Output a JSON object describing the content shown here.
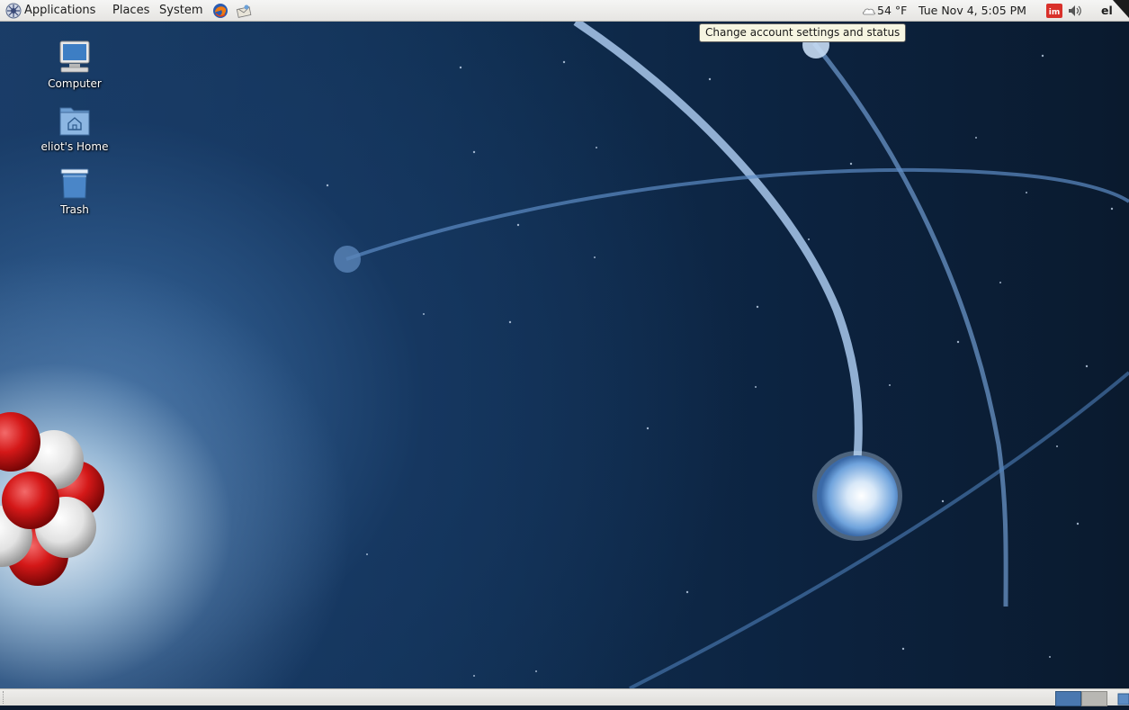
{
  "top_panel": {
    "menus": [
      "Applications",
      "Places",
      "System"
    ],
    "launchers": [
      {
        "icon": "firefox-icon"
      },
      {
        "icon": "mail-client-icon"
      }
    ],
    "tray": {
      "weather": "54 °F",
      "clock": "Tue Nov 4,  5:05 PM",
      "user": "el"
    }
  },
  "tooltip": "Change account settings and status",
  "desktop": {
    "icons": [
      {
        "label": "Computer",
        "icon": "computer-icon"
      },
      {
        "label": "eliot's Home",
        "icon": "home-folder-icon"
      },
      {
        "label": "Trash",
        "icon": "trash-icon"
      }
    ]
  },
  "bottom_panel": {
    "workspaces": 2,
    "active_workspace": 1
  },
  "colors": {
    "panel_bg": "#e6e5e2",
    "tooltip_bg": "#f6f5e1",
    "workspace_active": "#4a78b0",
    "im_badge": "#d9302a"
  }
}
